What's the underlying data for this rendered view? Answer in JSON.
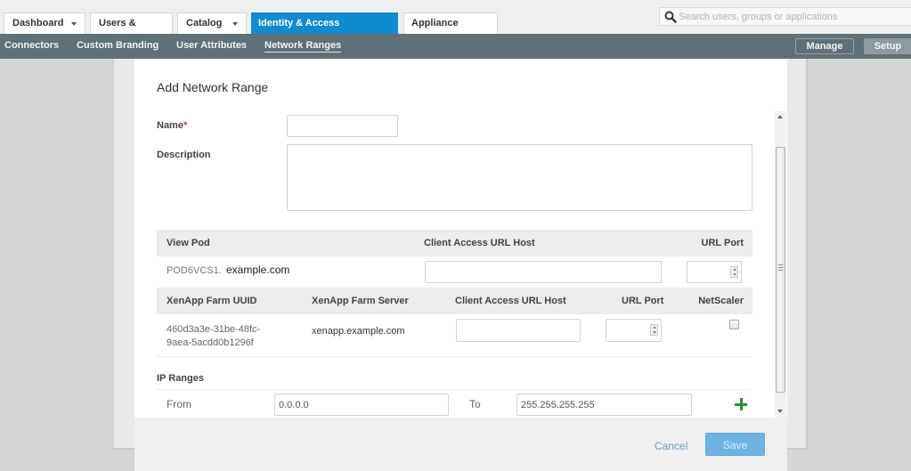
{
  "top_tabs": [
    {
      "label": "Dashboard",
      "has_dropdown": true,
      "active": false
    },
    {
      "label": "Users & Groups",
      "has_dropdown": false,
      "active": false
    },
    {
      "label": "Catalog",
      "has_dropdown": true,
      "active": false
    },
    {
      "label": "Identity & Access Management",
      "has_dropdown": false,
      "active": true
    },
    {
      "label": "Appliance Settings",
      "has_dropdown": false,
      "active": false
    }
  ],
  "search": {
    "placeholder": "Search users, groups or applications",
    "icon": "search-icon"
  },
  "subnav": {
    "items": [
      {
        "label": "Connectors",
        "current": false
      },
      {
        "label": "Custom Branding",
        "current": false
      },
      {
        "label": "User Attributes",
        "current": false
      },
      {
        "label": "Network Ranges",
        "current": true
      }
    ],
    "manage_label": "Manage",
    "setup_label": "Setup"
  },
  "modal": {
    "title": "Add Network Range",
    "name_label": "Name",
    "required_marker": "*",
    "name_value": "",
    "description_label": "Description",
    "description_value": "",
    "view_pod": {
      "headers": [
        "View Pod",
        "Client Access URL Host",
        "URL Port"
      ],
      "rows": [
        {
          "pod_prefix": "POD6VCS1.",
          "pod_domain": "example.com",
          "client_access_url_host": "",
          "url_port": ""
        }
      ]
    },
    "xenapp": {
      "headers": [
        "XenApp Farm UUID",
        "XenApp Farm Server",
        "Client Access URL Host",
        "URL Port",
        "NetScaler"
      ],
      "rows": [
        {
          "uuid_line1": "460d3a3e-31be-48fc-",
          "uuid_line2": "9aea-5acdd0b1296f",
          "server": "xenapp.example.com",
          "client_access_url_host": "",
          "url_port": "",
          "netscaler": false
        }
      ]
    },
    "ip_ranges": {
      "label": "IP Ranges",
      "from_label": "From",
      "to_label": "To",
      "rows": [
        {
          "from": "0.0.0.0",
          "to": "255.255.255.255"
        }
      ],
      "add_icon": "plus-icon"
    },
    "cancel_label": "Cancel",
    "save_label": "Save"
  },
  "colors": {
    "active_tab": "#0f8bd0",
    "subnav_bg": "#5f7078",
    "save_button": "#6eb4e3",
    "add_icon": "#2f8f2f",
    "required": "#d9302c"
  }
}
